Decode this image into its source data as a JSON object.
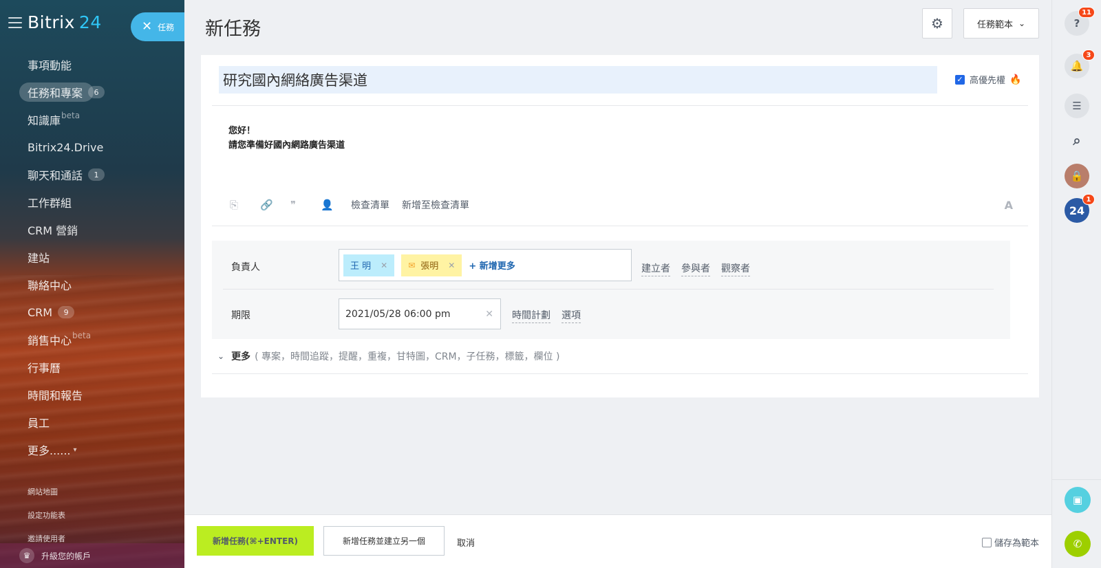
{
  "sidebar": {
    "logo_text": "Bitrix",
    "logo_num": "24",
    "tab_label": "任務",
    "menu": [
      {
        "label": "事項動能",
        "count": "",
        "sup": ""
      },
      {
        "label": "任務和專案",
        "count": "6",
        "sup": ""
      },
      {
        "label": "知識庫",
        "count": "",
        "sup": "beta"
      },
      {
        "label": "Bitrix24.Drive",
        "count": "",
        "sup": ""
      },
      {
        "label": "聊天和通話",
        "count": "1",
        "sup": ""
      },
      {
        "label": "工作群組",
        "count": "",
        "sup": ""
      },
      {
        "label": "CRM 營銷",
        "count": "",
        "sup": ""
      },
      {
        "label": "建站",
        "count": "",
        "sup": ""
      },
      {
        "label": "聯絡中心",
        "count": "",
        "sup": ""
      },
      {
        "label": "CRM",
        "count": "9",
        "sup": ""
      },
      {
        "label": "銷售中心",
        "count": "",
        "sup": "beta"
      },
      {
        "label": "行事曆",
        "count": "",
        "sup": ""
      },
      {
        "label": "時間和報告",
        "count": "",
        "sup": ""
      },
      {
        "label": "員工",
        "count": "",
        "sup": ""
      },
      {
        "label": "更多......",
        "count": "",
        "sup": ""
      }
    ],
    "sub_links": [
      "網站地圖",
      "設定功能表",
      "邀請使用者"
    ],
    "upgrade_label": "升級您的帳戶"
  },
  "header": {
    "title": "新任務",
    "template_button": "任務範本"
  },
  "task": {
    "title": "研究國內網絡廣告渠道",
    "priority_label": "高優先權",
    "description_lines": [
      "您好！",
      "請您準備好國內網路廣告渠道"
    ],
    "toolbar_links": [
      "檢查清單",
      "新增至檢查清單"
    ],
    "format_label": "A"
  },
  "fields": {
    "assignee_label": "負責人",
    "assignees": [
      "王 明",
      "張明"
    ],
    "add_more": "+ 新增更多",
    "role_links": [
      "建立者",
      "參與者",
      "觀察者"
    ],
    "deadline_label": "期限",
    "deadline_value": "2021/05/28 06:00 pm",
    "deadline_links": [
      "時間計劃",
      "選項"
    ]
  },
  "more": {
    "label": "更多",
    "list": "( 專案，時間追蹤，提醒，重複，甘特圖，CRM，子任務，標籤，欄位 )"
  },
  "footer": {
    "primary": "新增任務(⌘+ENTER)",
    "secondary": "新增任務並建立另一個",
    "cancel": "取消",
    "save_template": "儲存為範本"
  },
  "rail": {
    "help_badge": "11",
    "notify_badge": "3",
    "b24_label": "24",
    "b24_badge": "1"
  },
  "colors": {
    "accent_green": "#bbed21",
    "tab_blue": "#44b6e8",
    "badge_red": "#f54819"
  }
}
